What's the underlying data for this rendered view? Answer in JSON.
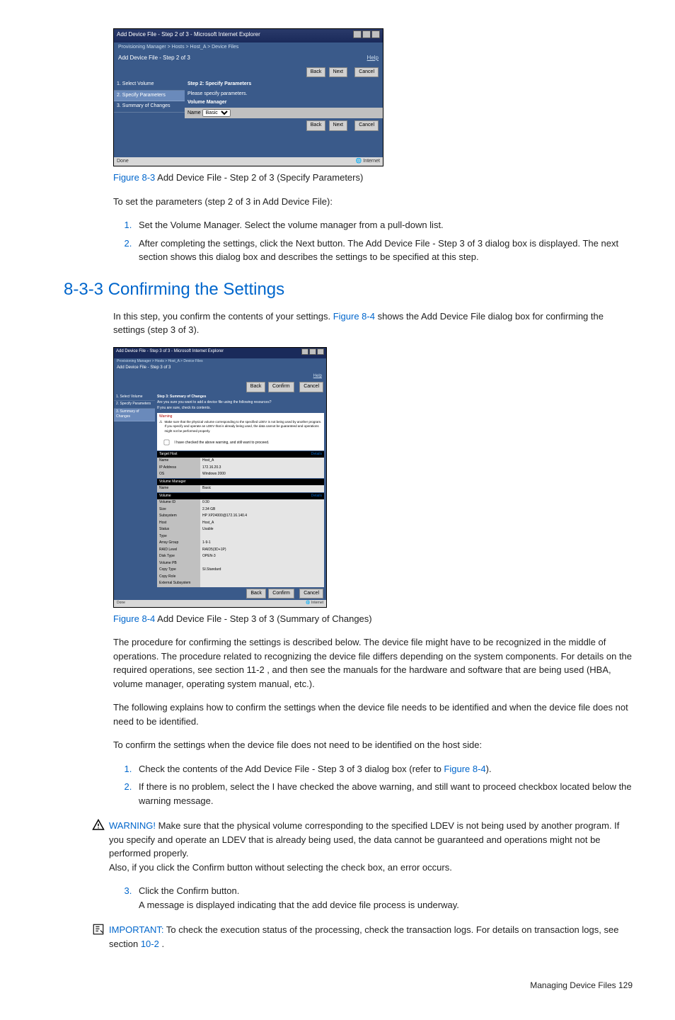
{
  "dialog1": {
    "title": "Add Device File - Step 2 of 3 - Microsoft Internet Explorer",
    "breadcrumb": "Provisioning Manager > Hosts > Host_A > Device Files",
    "subtitle": "Add Device File - Step 2 of 3",
    "help": "Help",
    "btn_back": "Back",
    "btn_next": "Next",
    "btn_cancel": "Cancel",
    "step1": "1. Select Volume",
    "step2": "2. Specify Parameters",
    "step3": "3. Summary of Changes",
    "right_hd": "Step 2: Specify Parameters",
    "right_txt": "Please specify parameters.",
    "vm_label": "Volume Manager",
    "name_label": "Name",
    "select_val": "Basic",
    "status_done": "Done",
    "status_net": "Internet"
  },
  "cap1_num": "Figure 8-3",
  "cap1_txt": " Add Device File - Step 2 of 3 (Specify Parameters)",
  "para1": "To set the parameters (step 2 of 3 in Add Device File):",
  "list1_1": "Set the Volume Manager. Select the volume manager from a pull-down list.",
  "list1_2": "After completing the settings, click the Next button. The Add Device File - Step 3 of 3 dialog box is displayed. The next section shows this dialog box and describes the settings to be specified at this step.",
  "section_title": "8-3-3 Confirming the Settings",
  "para2a": "In this step, you confirm the contents of your settings. ",
  "para2_link": "Figure 8-4",
  "para2b": " shows the Add Device File dialog box for confirming the settings (step 3 of 3).",
  "dialog2": {
    "title": "Add Device File - Step 3 of 3 - Microsoft Internet Explorer",
    "breadcrumb": "Provisioning Manager > Hosts > Host_A > Device Files",
    "subtitle": "Add Device File - Step 3 of 3",
    "help": "Help",
    "btn_back": "Back",
    "btn_confirm": "Confirm",
    "btn_cancel": "Cancel",
    "step1": "1. Select Volume",
    "step2": "2. Specify Parameters",
    "step3": "3. Summary of Changes",
    "right_hd": "Step 3: Summary of Changes",
    "q": "Are you sure you want to add a device file using the following resources?",
    "q2": "If you are sure, check its contents.",
    "warn_hd": "Warning",
    "warn_t": "WARNING",
    "warn_body": "Make sure that the physical volume corresponding to the specified LDEV is not being used by another program. If you specify and operate an LDEV that is already being used, the data cannot be guaranteed and operations might not be performed properly.",
    "chk": "I have checked the above warning, and still want to proceed.",
    "th_label": "Target Host",
    "details": "Details",
    "rows_host": [
      [
        "Name",
        "Host_A"
      ],
      [
        "IP Address",
        "172.16.20.3"
      ],
      [
        "OS",
        "Windows 2000"
      ]
    ],
    "vm_label": "Volume Manager",
    "rows_vm": [
      [
        "Name",
        "Basic"
      ]
    ],
    "vol_label": "Volume",
    "rows_vol": [
      [
        "Volume ID",
        "0:30"
      ],
      [
        "Size",
        "2.34 GB"
      ],
      [
        "Subsystem",
        "HP XP24000@172.16.140.4"
      ],
      [
        "Host",
        "Host_A"
      ],
      [
        "Status",
        "Usable"
      ],
      [
        "Type",
        ""
      ],
      [
        "Array Group",
        "1-9-1"
      ],
      [
        "RAID Level",
        "RAID5(3D+1P)"
      ],
      [
        "Disk Type",
        "OPEN-3"
      ],
      [
        "Volume PB",
        ""
      ],
      [
        "Copy Type",
        "SI.Standard"
      ],
      [
        "Copy Role",
        ""
      ],
      [
        "External Subsystem",
        ""
      ]
    ],
    "status_done": "Done",
    "status_net": "Internet"
  },
  "cap2_num": "Figure 8-4",
  "cap2_txt": " Add Device File - Step 3 of 3 (Summary of Changes)",
  "para3": "The procedure for confirming the settings is described below. The device file might have to be recognized in the middle of operations. The procedure related to recognizing the device file differs depending on the system components. For details on the required operations, see section 11-2 , and then see the manuals for the hardware and software that are being used (HBA, volume manager, operating system manual, etc.).",
  "para4": "The following explains how to confirm the settings when the device file needs to be identified and when the device file does not need to be identified.",
  "para5": "To confirm the settings when the device file does not need to be identified on the host side:",
  "list2_1a": "Check the contents of the Add Device File - Step 3 of 3 dialog box (refer to ",
  "list2_1link": "Figure 8-4",
  "list2_1b": ").",
  "list2_2": "If there is no problem, select the I have checked the above warning, and still want to proceed checkbox located below the warning message.",
  "warn_label": "WARNING!",
  "warn_text": "  Make sure that the physical volume corresponding to the specified LDEV is not being used by another program. If you specify and operate an LDEV that is already being used, the data cannot be guaranteed and operations might not be performed properly.",
  "warn_text2": "Also, if you click the Confirm button without selecting the check box, an error occurs.",
  "list2_3a": "Click the Confirm button.",
  "list2_3b": "A message is displayed indicating that the add device file process is underway.",
  "imp_label": "IMPORTANT:",
  "imp_text": "  To check the execution status of the processing, check the transaction logs. For details on transaction logs, see section ",
  "imp_link": "10-2",
  "imp_end": " .",
  "footer_label": "Managing Device Files",
  "footer_page": "  129"
}
